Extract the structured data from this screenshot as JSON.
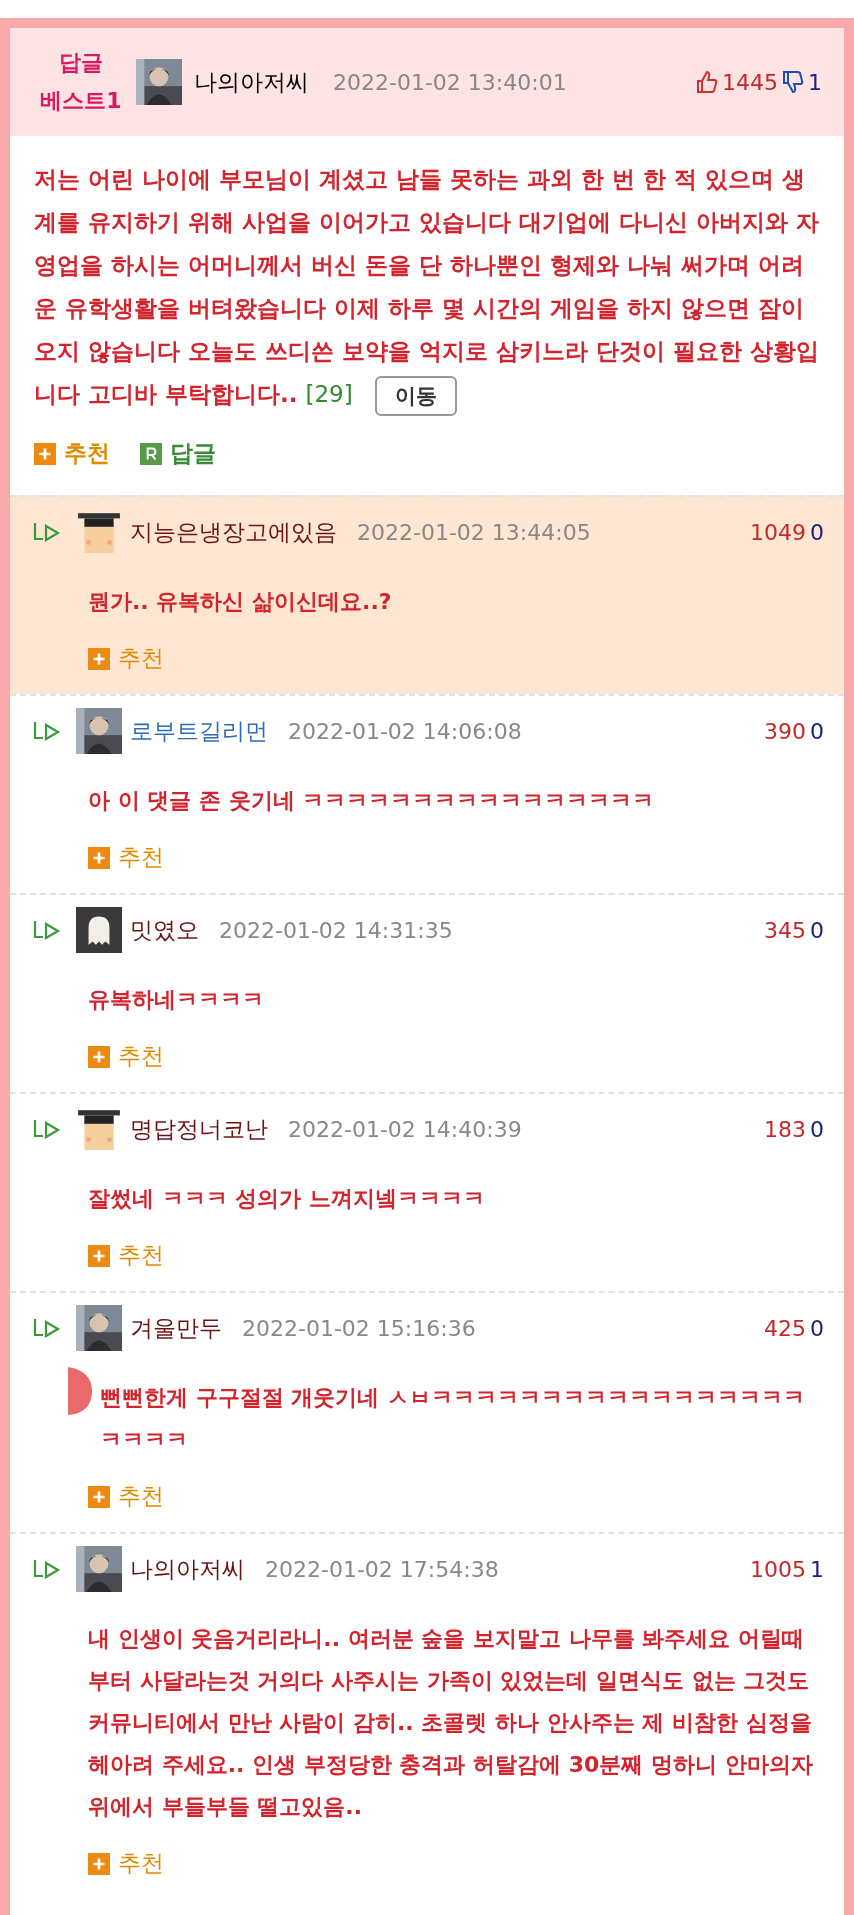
{
  "best": {
    "badge": [
      "답글",
      "베스트1"
    ],
    "author": {
      "name": "나의아저씨"
    },
    "time": "2022-01-02 13:40:01",
    "up": "1445",
    "down": "1",
    "text": "저는 어린 나이에 부모님이 계셨고 남들 못하는 과외 한 번 한 적 있으며 생계를 유지하기 위해 사업을 이어가고 있습니다 대기업에 다니신 아버지와 자영업을 하시는 어머니께서 버신 돈을 단 하나뿐인 형제와 나눠 써가며 어려운 유학생활을 버텨왔습니다 이제 하루 몇 시간의 게임을 하지 않으면 잠이 오지 않습니다 오늘도 쓰디쓴 보약을 억지로 삼키느라 단것이 필요한 상황입니다 고디바 부탁합니다..",
    "count": "[29]",
    "move_button": "이동",
    "recommend": "추천",
    "reply": "답글"
  },
  "replies": [
    {
      "name": "지능은냉장고에있음",
      "color": "#6b1414",
      "avatar": {
        "kind": "student"
      },
      "time": "2022-01-02 13:44:05",
      "up": "1049",
      "down": "0",
      "text": "뭔가.. 유복하신 삶이신데요..?",
      "recommend": "추천",
      "highlighted": true,
      "redacted": false
    },
    {
      "name": "로부트길리먼",
      "color": "#2e6db4",
      "time": "2022-01-02 14:06:08",
      "up": "390",
      "down": "0",
      "text": "아 이 댓글 존 웃기네 ㅋㅋㅋㅋㅋㅋㅋㅋㅋㅋㅋㅋㅋㅋㅋㅋ",
      "recommend": "추천",
      "highlighted": false,
      "redacted": false
    },
    {
      "name": "밋였오",
      "color": "#6b1414",
      "avatar": {
        "kind": "ghost"
      },
      "time": "2022-01-02 14:31:35",
      "up": "345",
      "down": "0",
      "text": "유복하네ㅋㅋㅋㅋ",
      "recommend": "추천",
      "highlighted": false,
      "redacted": false
    },
    {
      "name": "명답정너코난",
      "color": "#6b1414",
      "avatar": {
        "kind": "student"
      },
      "time": "2022-01-02 14:40:39",
      "up": "183",
      "down": "0",
      "text": "잘썼네 ㅋㅋㅋ 성의가 느껴지넼ㅋㅋㅋㅋ",
      "recommend": "추천",
      "highlighted": false,
      "redacted": false
    },
    {
      "name": "겨울만두",
      "color": "#6b1414",
      "time": "2022-01-02 15:16:36",
      "up": "425",
      "down": "0",
      "text": "뻔뻔한게 구구절절 개웃기네 ㅅㅂㅋㅋㅋㅋㅋㅋㅋㅋㅋㅋㅋㅋㅋㅋㅋㅋㅋㅋㅋㅋㅋ",
      "recommend": "추천",
      "highlighted": false,
      "redacted": true
    },
    {
      "name": "나의아저씨",
      "color": "#6b1414",
      "time": "2022-01-02 17:54:38",
      "up": "1005",
      "down": "1",
      "text": "내 인생이 웃음거리라니.. 여러분 숲을 보지말고 나무를 봐주세요 어릴때부터 사달라는것 거의다 사주시는 가족이 있었는데 일면식도 없는 그것도 커뮤니티에서 만난 사람이 감히.. 초콜렛 하나 안사주는 제 비참한 심정을 헤아려 주세요.. 인생 부정당한 충격과 허탈감에 30분째 멍하니 안마의자 위에서 부들부들 떨고있음..",
      "recommend": "추천",
      "highlighted": false,
      "redacted": false
    }
  ]
}
